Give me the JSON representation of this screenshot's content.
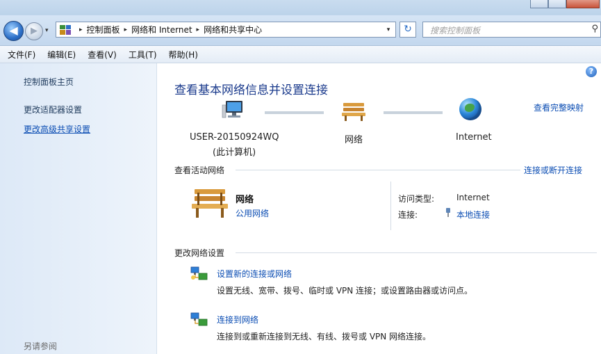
{
  "window": {
    "title": "网络和共享中心"
  },
  "navigation": {
    "back_glyph": "◀",
    "forward_glyph": "▶",
    "history_glyph": "▾",
    "breadcrumbs": [
      "控制面板",
      "网络和 Internet",
      "网络和共享中心"
    ],
    "separator": "▸",
    "address_dropdown_glyph": "▾",
    "refresh_glyph": "↻",
    "search_placeholder": "搜索控制面板",
    "search_glyph": "⚲"
  },
  "menubar": {
    "items": [
      "文件(F)",
      "编辑(E)",
      "查看(V)",
      "工具(T)",
      "帮助(H)"
    ]
  },
  "sidebar": {
    "items": [
      {
        "label": "控制面板主页"
      },
      {
        "label": "更改适配器设置"
      },
      {
        "label": "更改高级共享设置"
      }
    ],
    "see_also": "另请参阅"
  },
  "main": {
    "help_glyph": "?",
    "heading": "查看基本网络信息并设置连接",
    "full_map_link": "查看完整映射",
    "map": {
      "computer_name": "USER-20150924WQ",
      "computer_sub": "(此计算机)",
      "network": "网络",
      "internet": "Internet"
    },
    "active_networks": {
      "title": "查看活动网络",
      "connect_link": "连接或断开连接",
      "network_name": "网络",
      "network_type": "公用网络",
      "access_type_label": "访问类型:",
      "access_type_value": "Internet",
      "connections_label": "连接:",
      "connections_value": "本地连接"
    },
    "change_settings": {
      "title": "更改网络设置",
      "tasks": [
        {
          "title": "设置新的连接或网络",
          "desc": "设置无线、宽带、拨号、临时或 VPN 连接；或设置路由器或访问点。"
        },
        {
          "title": "连接到网络",
          "desc": "连接到或重新连接到无线、有线、拨号或 VPN 网络连接。"
        }
      ]
    }
  },
  "colors": {
    "link": "#0b4db3",
    "heading": "#1a3a8c",
    "sidebar_bg": "#dde9f7"
  }
}
